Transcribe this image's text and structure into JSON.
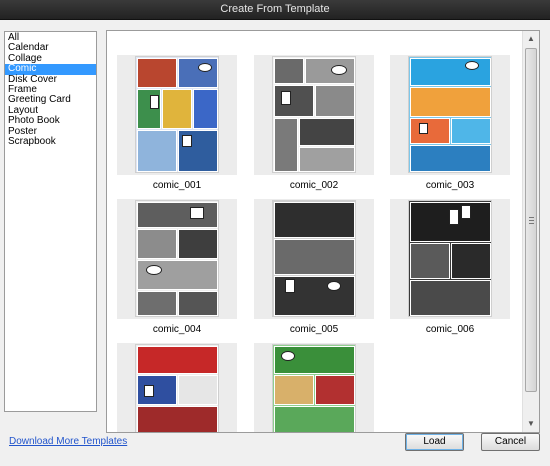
{
  "window": {
    "title": "Create From Template"
  },
  "categories": {
    "items": [
      {
        "label": "All"
      },
      {
        "label": "Calendar"
      },
      {
        "label": "Collage"
      },
      {
        "label": "Comic",
        "selected": true
      },
      {
        "label": "Disk Cover"
      },
      {
        "label": "Frame"
      },
      {
        "label": "Greeting Card"
      },
      {
        "label": "Layout"
      },
      {
        "label": "Photo Book"
      },
      {
        "label": "Poster"
      },
      {
        "label": "Scrapbook"
      }
    ]
  },
  "gallery": {
    "templates": [
      {
        "label": "comic_001",
        "accent": "#3b67c7"
      },
      {
        "label": "comic_002",
        "accent": "#777777"
      },
      {
        "label": "comic_003",
        "accent": "#2aa3e0"
      },
      {
        "label": "comic_004",
        "accent": "#555555"
      },
      {
        "label": "comic_005",
        "accent": "#333333"
      },
      {
        "label": "comic_006",
        "accent": "#2a2a2a"
      },
      {
        "label": "",
        "accent": "#c62828"
      },
      {
        "label": "",
        "accent": "#3a8f3a"
      }
    ]
  },
  "footer": {
    "download_link": "Download More Templates",
    "load_label": "Load",
    "cancel_label": "Cancel"
  },
  "colors": {
    "selection": "#3399ff",
    "link": "#2255cc"
  }
}
